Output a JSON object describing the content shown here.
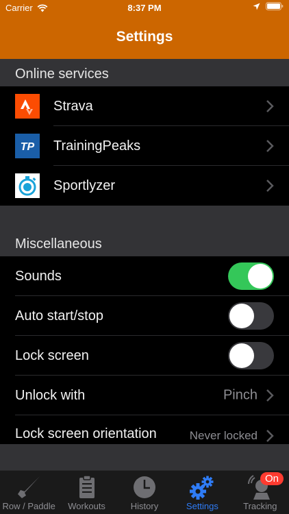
{
  "status_bar": {
    "carrier": "Carrier",
    "time": "8:37 PM"
  },
  "nav": {
    "title": "Settings"
  },
  "online_services": {
    "header": "Online services",
    "items": [
      {
        "label": "Strava",
        "icon": "strava-logo"
      },
      {
        "label": "TrainingPeaks",
        "icon": "trainingpeaks-logo",
        "icon_text": "TP"
      },
      {
        "label": "Sportlyzer",
        "icon": "sportlyzer-logo"
      }
    ]
  },
  "miscellaneous": {
    "header": "Miscellaneous",
    "sounds": {
      "label": "Sounds",
      "enabled": true
    },
    "auto_start": {
      "label": "Auto start/stop",
      "enabled": false
    },
    "lock_screen": {
      "label": "Lock screen",
      "enabled": false
    },
    "unlock_with": {
      "label": "Unlock with",
      "value": "Pinch"
    },
    "lock_orientation": {
      "label": "Lock screen orientation",
      "value": "Never locked"
    }
  },
  "tabs": [
    {
      "label": "Row / Paddle",
      "icon": "rower-icon"
    },
    {
      "label": "Workouts",
      "icon": "clipboard-icon"
    },
    {
      "label": "History",
      "icon": "clock-icon"
    },
    {
      "label": "Settings",
      "icon": "gears-icon",
      "active": true
    },
    {
      "label": "Tracking",
      "icon": "tracking-icon",
      "badge": "On"
    }
  ],
  "colors": {
    "nav_bar": "#cc6600",
    "toggle_on": "#34c759",
    "tab_active": "#2f7cf6",
    "badge": "#ff3b30"
  }
}
